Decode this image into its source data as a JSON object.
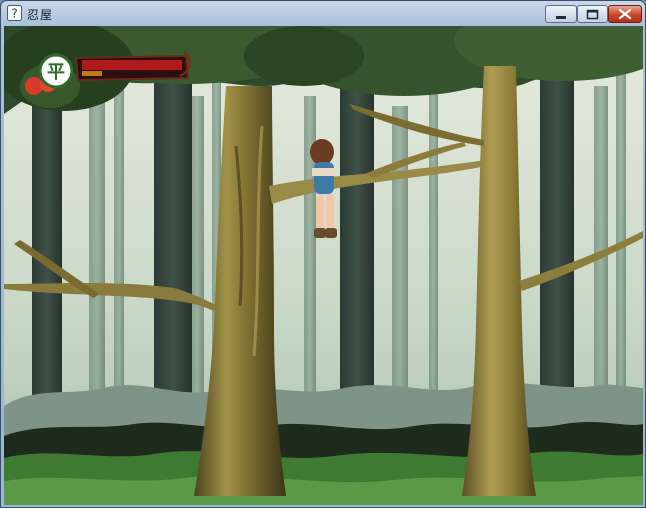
{
  "window": {
    "title": "忍屋",
    "buttons": {
      "minimize_icon": "minimize-icon",
      "maximize_icon": "maximize-icon",
      "close_icon": "close-icon"
    }
  },
  "hud": {
    "emblem_text": "平",
    "health_fraction": 1.0,
    "stamina_fraction": 0.2,
    "colors": {
      "health": "#b01a1a",
      "stamina": "#c07a1a",
      "frame": "#5a1a1a"
    }
  }
}
